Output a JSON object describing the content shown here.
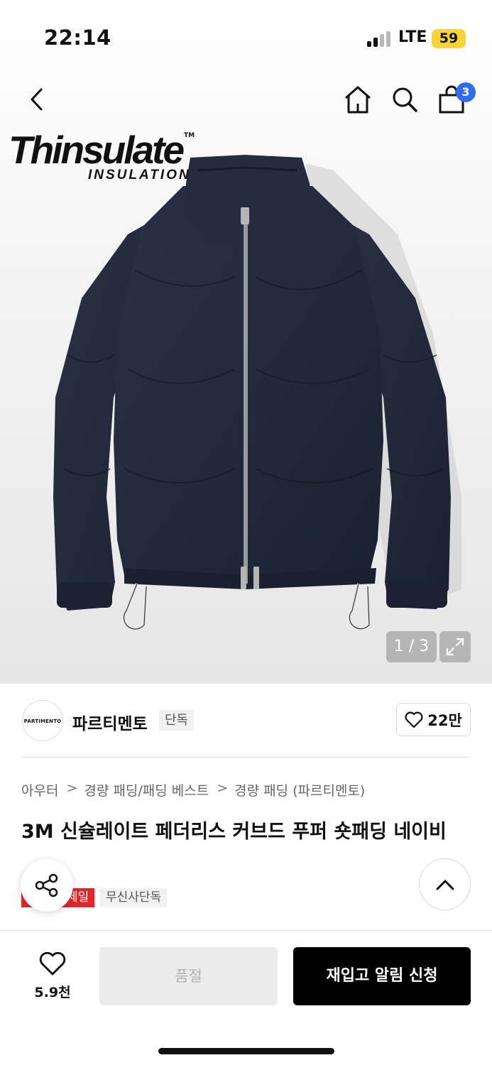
{
  "status_bar": {
    "time": "22:14",
    "network": "LTE",
    "battery": "59"
  },
  "nav": {
    "cart_count": "3",
    "icons": [
      "back-icon",
      "home-icon",
      "search-icon",
      "cart-icon"
    ]
  },
  "image": {
    "logo_main": "Thinsulate",
    "logo_tm": "TM",
    "logo_sub": "INSULATION",
    "counter": "1 / 3"
  },
  "brand": {
    "logo_text": "PARTIMENTO",
    "name": "파르티멘토",
    "exclusive_tag": "단독",
    "likes": "22만"
  },
  "product": {
    "breadcrumb": [
      "아우터",
      "경량 패딩/패딩 베스트",
      "경량 패딩 (파르티멘토)"
    ],
    "title": "3M 신슐레이트 페더리스 커브드 푸퍼 숏패딩 네이비",
    "tags": {
      "sale": "세일",
      "musinsa": "무신사단독"
    }
  },
  "bottom_bar": {
    "wish_count": "5.9천",
    "soldout_label": "품절",
    "restock_label": "재입고 알림 신청"
  },
  "colors": {
    "accent_blue": "#2f6cf5",
    "sale_red": "#e3262b",
    "battery_yellow": "#f8d33a",
    "jacket_navy": "#232a3b"
  }
}
